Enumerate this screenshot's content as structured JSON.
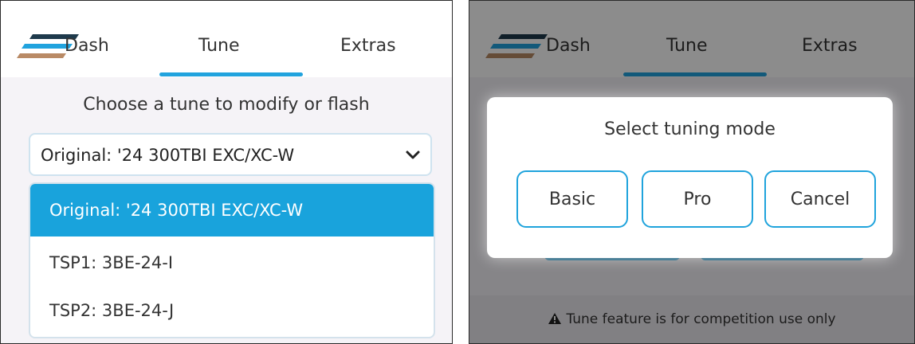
{
  "left_screen": {
    "tabs": [
      {
        "label": "Dash"
      },
      {
        "label": "Tune",
        "active": true
      },
      {
        "label": "Extras"
      }
    ],
    "heading": "Choose a tune to modify or flash",
    "tune_select": {
      "value": "Original: '24 300TBI EXC/XC-W",
      "options": [
        {
          "label": "Original: '24 300TBI EXC/XC-W",
          "selected": true
        },
        {
          "label": "TSP1: 3BE-24-I"
        },
        {
          "label": "TSP2: 3BE-24-J"
        }
      ]
    }
  },
  "right_screen": {
    "tabs": [
      {
        "label": "Dash"
      },
      {
        "label": "Tune",
        "active": true
      },
      {
        "label": "Extras"
      }
    ],
    "dialog": {
      "title": "Select tuning mode",
      "buttons": [
        {
          "label": "Basic"
        },
        {
          "label": "Pro"
        },
        {
          "label": "Cancel"
        }
      ]
    },
    "notice": "Tune feature is for competition use only"
  },
  "colors": {
    "accent": "#1fa3dc",
    "logo_stripes": [
      "#1e3a4c",
      "#21a3de",
      "#b98a65"
    ],
    "content_background": "#f5f3f7"
  },
  "icons": {
    "logo": "striped-logo-icon",
    "dropdown": "chevron-down-icon",
    "warning": "warning-triangle-icon"
  }
}
